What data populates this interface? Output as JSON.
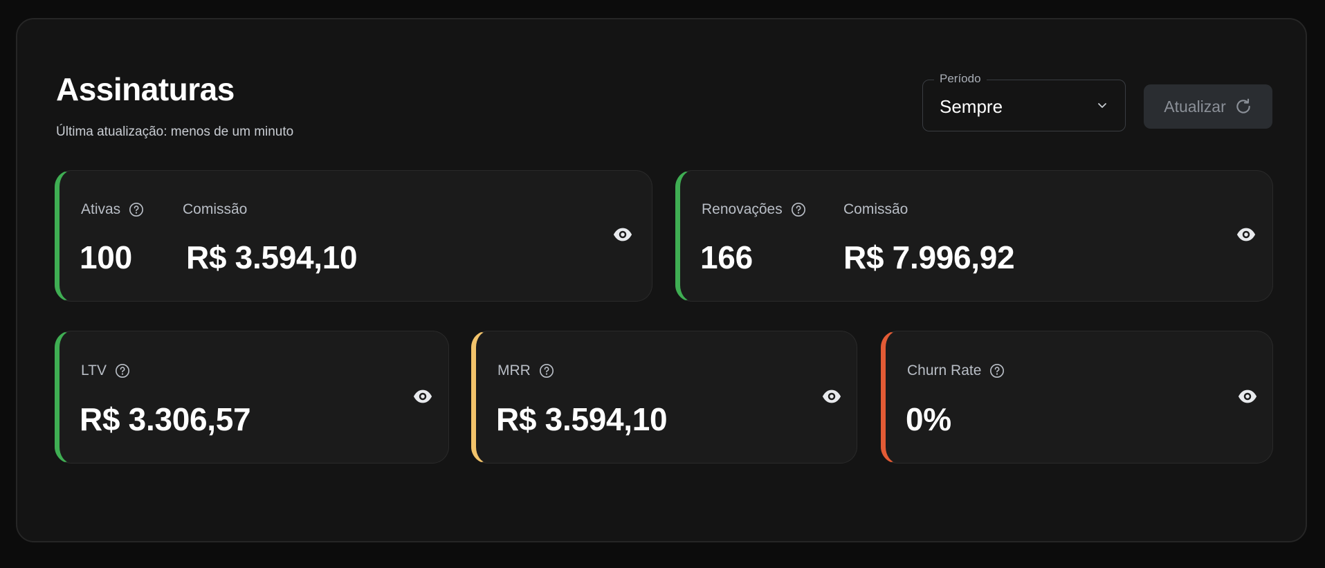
{
  "header": {
    "title": "Assinaturas",
    "last_update": "Última atualização: menos de um minuto"
  },
  "period_select": {
    "label": "Período",
    "value": "Sempre"
  },
  "refresh_button": {
    "label": "Atualizar"
  },
  "cards": {
    "ativas": {
      "label": "Ativas",
      "value": "100",
      "commission_label": "Comissão",
      "commission_value": "R$ 3.594,10",
      "accent": "#3fae53"
    },
    "renovacoes": {
      "label": "Renovações",
      "value": "166",
      "commission_label": "Comissão",
      "commission_value": "R$ 7.996,92",
      "accent": "#3fae53"
    },
    "ltv": {
      "label": "LTV",
      "value": "R$ 3.306,57",
      "accent": "#3fae53"
    },
    "mrr": {
      "label": "MRR",
      "value": "R$ 3.594,10",
      "accent": "#f2c36b"
    },
    "churn": {
      "label": "Churn Rate",
      "value": "0%",
      "accent": "#e35b35"
    }
  },
  "icons": {
    "help": "help-circle-icon",
    "visibility": "eye-icon",
    "dropdown": "chevron-down-icon",
    "refresh": "refresh-icon"
  },
  "colors": {
    "background": "#0c0c0c",
    "panel": "#141414",
    "card": "#1b1b1b",
    "positive": "#3fae53",
    "warning": "#f2c36b",
    "negative": "#e35b35"
  }
}
